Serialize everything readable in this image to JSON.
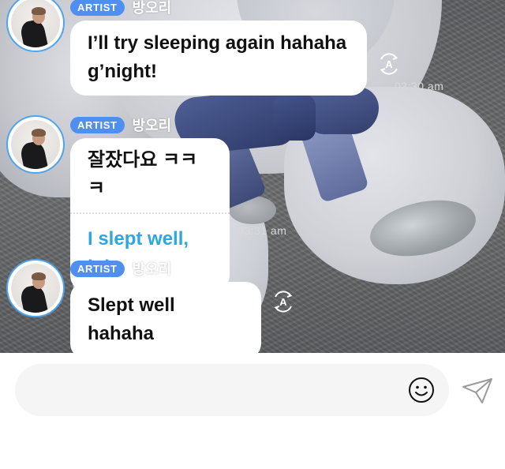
{
  "messages": [
    {
      "sender_badge": "ARTIST",
      "sender_name": "방오리",
      "lines": [
        "I’ll try sleeping again hahaha",
        "g’night!"
      ],
      "time": "03:30 am"
    },
    {
      "sender_badge": "ARTIST",
      "sender_name": "방오리",
      "original": "잘잤다요 ㅋㅋㅋ",
      "translated": "I slept well, lol",
      "time": "03:31 am"
    },
    {
      "sender_badge": "ARTIST",
      "sender_name": "방오리",
      "lines": [
        "Slept well hahaha"
      ]
    }
  ],
  "composer": {
    "placeholder": "",
    "emoji_icon": "smiley-face-icon",
    "send_icon": "paper-plane-icon"
  },
  "colors": {
    "artist_badge": "#4f8ff0",
    "avatar_ring": "#4fa4ea",
    "translation_text": "#2ea7e0",
    "bubble_bg": "#ffffff",
    "composer_bg": "#f5f5f5"
  }
}
